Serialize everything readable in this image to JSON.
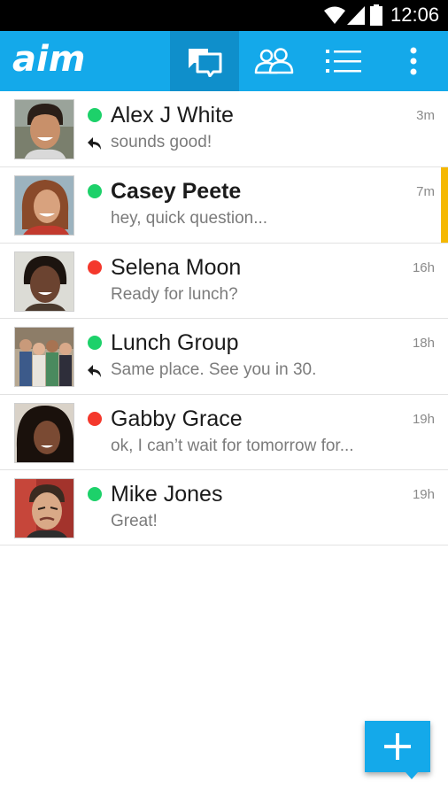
{
  "status_bar": {
    "time": "12:06",
    "icons": [
      "wifi-icon",
      "cell-signal-icon",
      "battery-icon"
    ]
  },
  "app_bar": {
    "logo": "aim",
    "tabs": [
      {
        "name": "chats",
        "icon": "chat-bubbles-icon",
        "selected": true
      },
      {
        "name": "buddies",
        "icon": "buddies-icon",
        "selected": false
      },
      {
        "name": "feed",
        "icon": "list-icon",
        "selected": false
      }
    ],
    "menu_icon": "overflow-menu-icon"
  },
  "conversations": [
    {
      "name": "Alex J White",
      "preview": "sounds good!",
      "time": "3m",
      "status": "online",
      "replied": true,
      "unread": false
    },
    {
      "name": "Casey Peete",
      "preview": "hey, quick question...",
      "time": "7m",
      "status": "online",
      "replied": false,
      "unread": true
    },
    {
      "name": "Selena Moon",
      "preview": "Ready for lunch?",
      "time": "16h",
      "status": "away",
      "replied": false,
      "unread": false
    },
    {
      "name": "Lunch Group",
      "preview": "Same place. See you in 30.",
      "time": "18h",
      "status": "online",
      "replied": true,
      "unread": false
    },
    {
      "name": "Gabby Grace",
      "preview": "ok, I can’t wait for tomorrow for...",
      "time": "19h",
      "status": "away",
      "replied": false,
      "unread": false
    },
    {
      "name": "Mike Jones",
      "preview": "Great!",
      "time": "19h",
      "status": "online",
      "replied": false,
      "unread": false
    }
  ],
  "fab": {
    "icon": "plus-icon"
  },
  "colors": {
    "brand": "#14a9ea",
    "tab_selected": "#0f8fcb",
    "online": "#1dd16a",
    "away": "#f4382c",
    "unread_marker": "#f5b800"
  }
}
